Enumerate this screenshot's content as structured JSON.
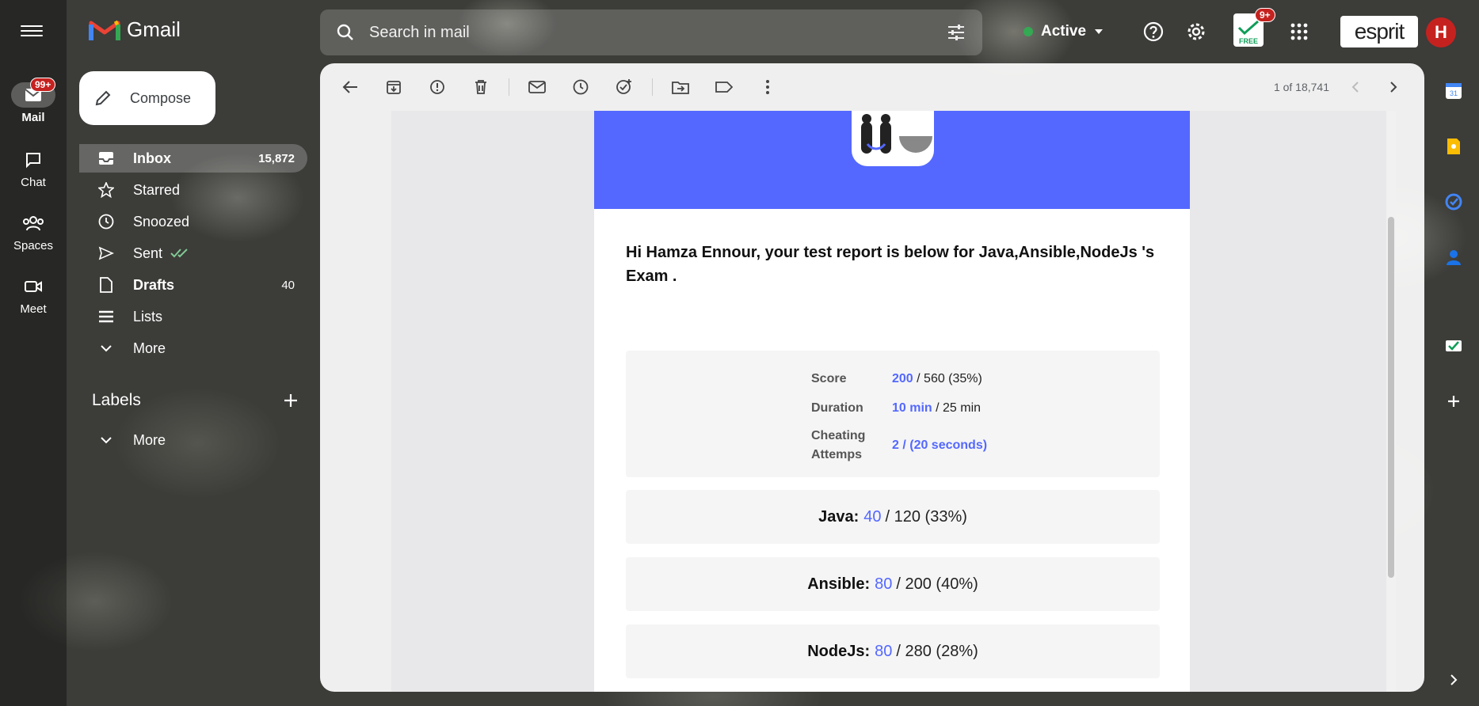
{
  "rail": {
    "items": [
      {
        "label": "Mail",
        "badge": "99+"
      },
      {
        "label": "Chat"
      },
      {
        "label": "Spaces"
      },
      {
        "label": "Meet"
      }
    ]
  },
  "header": {
    "app_name": "Gmail",
    "search_placeholder": "Search in mail",
    "status": "Active",
    "notif_badge": "9+",
    "notif_label": "FREE",
    "org_logo": "esprit",
    "avatar_letter": "H"
  },
  "nav": {
    "compose": "Compose",
    "items": [
      {
        "label": "Inbox",
        "count": "15,872"
      },
      {
        "label": "Starred",
        "count": ""
      },
      {
        "label": "Snoozed",
        "count": ""
      },
      {
        "label": "Sent",
        "count": ""
      },
      {
        "label": "Drafts",
        "count": "40"
      },
      {
        "label": "Lists",
        "count": ""
      },
      {
        "label": "More",
        "count": ""
      }
    ],
    "labels_title": "Labels",
    "labels_more": "More"
  },
  "toolbar": {
    "pager": "1 of 18,741"
  },
  "email": {
    "greeting": "Hi Hamza Ennour, your test report is below for Java,Ansible,NodeJs 's Exam .",
    "summary": [
      {
        "key": "Score",
        "got": "200",
        "rest": " / 560 (35%)"
      },
      {
        "key": "Duration",
        "got": "10 min",
        "rest": " / 25 min"
      },
      {
        "key": "Cheating Attemps",
        "got": "2 / (20 seconds)",
        "rest": ""
      }
    ],
    "sections": [
      {
        "name": "Java:",
        "got": "40",
        "rest": "/ 120 (33%)"
      },
      {
        "name": "Ansible:",
        "got": "80",
        "rest": "/ 200 (40%)"
      },
      {
        "name": "NodeJs:",
        "got": "80",
        "rest": "/ 280 (28%)"
      }
    ]
  },
  "colors": {
    "accent": "#5468ff",
    "badge": "#c5221f",
    "active_dot": "#34a853"
  }
}
